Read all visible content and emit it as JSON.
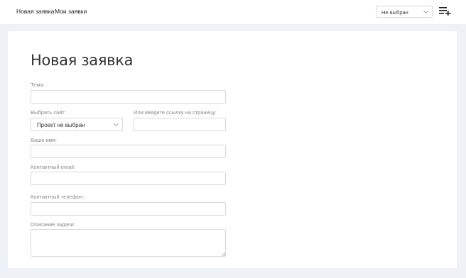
{
  "nav": {
    "new_request": "Новая заявка",
    "my_requests": "Мои заявки"
  },
  "header": {
    "project_select_value": "Не выбран",
    "add_icon": "playlist-add-icon"
  },
  "form": {
    "title": "Новая заявка",
    "subject_label": "Тема:",
    "subject_value": "",
    "site_label": "Выбрать сайт:",
    "site_value": "Проект не выбран",
    "page_link_label": "Или введите ссылку на страницу:",
    "page_link_value": "",
    "name_label": "Ваше имя:",
    "name_value": "",
    "email_label": "Контактный email:",
    "email_value": "",
    "phone_label": "Контактный телефон:",
    "phone_value": "",
    "description_label": "Описание задачи:",
    "description_value": ""
  },
  "colors": {
    "background": "#eef1f5",
    "card": "#ffffff",
    "border": "#d6d9dd",
    "label": "#888888"
  }
}
